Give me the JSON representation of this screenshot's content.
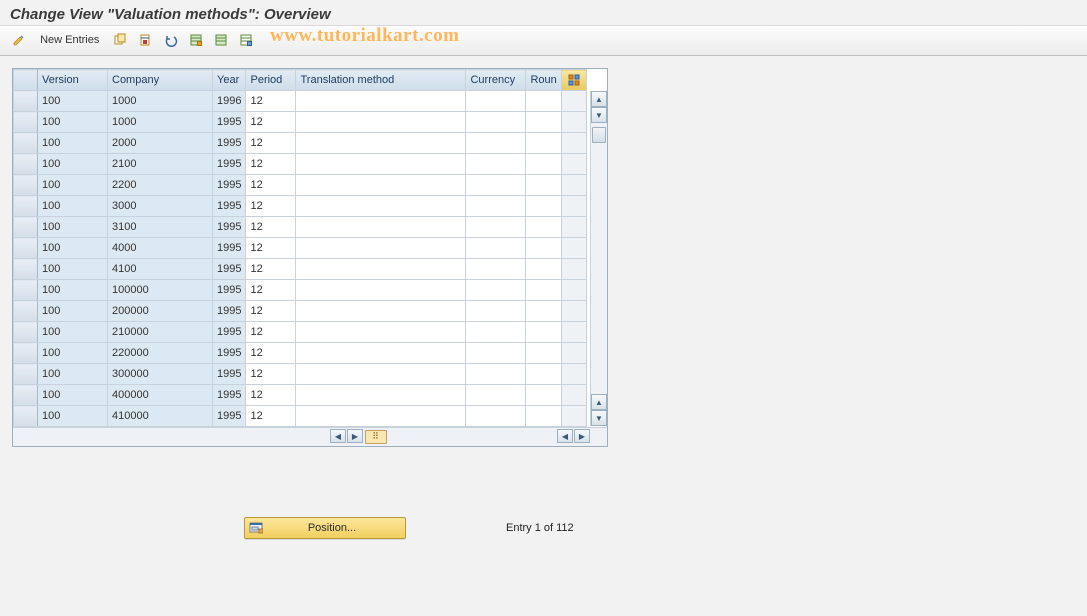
{
  "title": "Change View \"Valuation methods\": Overview",
  "watermark": "www.tutorialkart.com",
  "toolbar": {
    "new_entries_label": "New Entries"
  },
  "columns": {
    "version": "Version",
    "company": "Company",
    "year": "Year",
    "period": "Period",
    "translation": "Translation method",
    "currency": "Currency",
    "round": "Roun"
  },
  "chart_data": {
    "type": "table",
    "columns": [
      "Version",
      "Company",
      "Year",
      "Period",
      "Translation method",
      "Currency",
      "Roun"
    ],
    "rows": [
      {
        "version": "100",
        "company": "1000",
        "year": "1996",
        "period": "12",
        "translation": "",
        "currency": "",
        "round": ""
      },
      {
        "version": "100",
        "company": "1000",
        "year": "1995",
        "period": "12",
        "translation": "",
        "currency": "",
        "round": ""
      },
      {
        "version": "100",
        "company": "2000",
        "year": "1995",
        "period": "12",
        "translation": "",
        "currency": "",
        "round": ""
      },
      {
        "version": "100",
        "company": "2100",
        "year": "1995",
        "period": "12",
        "translation": "",
        "currency": "",
        "round": ""
      },
      {
        "version": "100",
        "company": "2200",
        "year": "1995",
        "period": "12",
        "translation": "",
        "currency": "",
        "round": ""
      },
      {
        "version": "100",
        "company": "3000",
        "year": "1995",
        "period": "12",
        "translation": "",
        "currency": "",
        "round": ""
      },
      {
        "version": "100",
        "company": "3100",
        "year": "1995",
        "period": "12",
        "translation": "",
        "currency": "",
        "round": ""
      },
      {
        "version": "100",
        "company": "4000",
        "year": "1995",
        "period": "12",
        "translation": "",
        "currency": "",
        "round": ""
      },
      {
        "version": "100",
        "company": "4100",
        "year": "1995",
        "period": "12",
        "translation": "",
        "currency": "",
        "round": ""
      },
      {
        "version": "100",
        "company": "100000",
        "year": "1995",
        "period": "12",
        "translation": "",
        "currency": "",
        "round": ""
      },
      {
        "version": "100",
        "company": "200000",
        "year": "1995",
        "period": "12",
        "translation": "",
        "currency": "",
        "round": ""
      },
      {
        "version": "100",
        "company": "210000",
        "year": "1995",
        "period": "12",
        "translation": "",
        "currency": "",
        "round": ""
      },
      {
        "version": "100",
        "company": "220000",
        "year": "1995",
        "period": "12",
        "translation": "",
        "currency": "",
        "round": ""
      },
      {
        "version": "100",
        "company": "300000",
        "year": "1995",
        "period": "12",
        "translation": "",
        "currency": "",
        "round": ""
      },
      {
        "version": "100",
        "company": "400000",
        "year": "1995",
        "period": "12",
        "translation": "",
        "currency": "",
        "round": ""
      },
      {
        "version": "100",
        "company": "410000",
        "year": "1995",
        "period": "12",
        "translation": "",
        "currency": "",
        "round": ""
      }
    ]
  },
  "footer": {
    "position_label": "Position...",
    "entry_text": "Entry 1 of 112"
  }
}
